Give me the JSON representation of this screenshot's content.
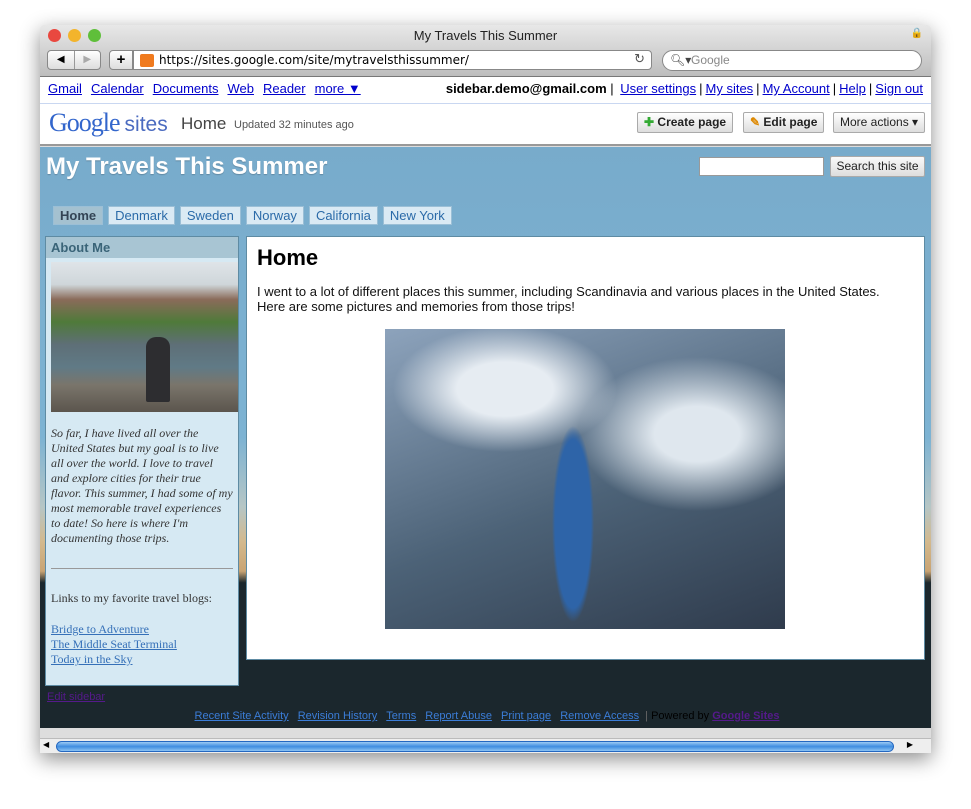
{
  "browser": {
    "title": "My Travels This Summer",
    "url": "https://sites.google.com/site/mytravelsthissummer/",
    "search_placeholder": "Google"
  },
  "gbar": {
    "links": [
      "Gmail",
      "Calendar",
      "Documents",
      "Web",
      "Reader",
      "more ▼"
    ],
    "email": "sidebar.demo@gmail.com",
    "right_links": [
      "User settings",
      "My sites",
      "My Account",
      "Help",
      "Sign out"
    ]
  },
  "sites_header": {
    "logo_google": "Google",
    "logo_sites": "sites",
    "page": "Home",
    "updated": "Updated 32 minutes ago",
    "create": "Create page",
    "edit": "Edit page",
    "more": "More actions ▾"
  },
  "site": {
    "title": "My Travels This Summer",
    "search_button": "Search this site",
    "tabs": [
      "Home",
      "Denmark",
      "Sweden",
      "Norway",
      "California",
      "New York"
    ]
  },
  "sidebar": {
    "heading": "About Me",
    "about": "So far, I have lived all over the United States but my goal is to live all over the world. I love to travel and explore cities for their true flavor. This summer, I had some of my most memorable travel experiences to date! So here is where I'm documenting those trips.",
    "links_heading": "Links to my favorite travel blogs:",
    "links": [
      "Bridge to Adventure",
      "The Middle Seat Terminal",
      "Today in the Sky"
    ]
  },
  "main": {
    "heading": "Home",
    "intro": "I went to a lot of different places this summer, including Scandinavia and various places in the United States. Here are some pictures and memories from those trips!"
  },
  "footer": {
    "edit_sidebar": "Edit sidebar",
    "links": [
      "Recent Site Activity",
      "Revision History",
      "Terms",
      "Report Abuse",
      "Print page",
      "Remove Access"
    ],
    "powered": "Powered by",
    "google_sites": "Google Sites"
  }
}
